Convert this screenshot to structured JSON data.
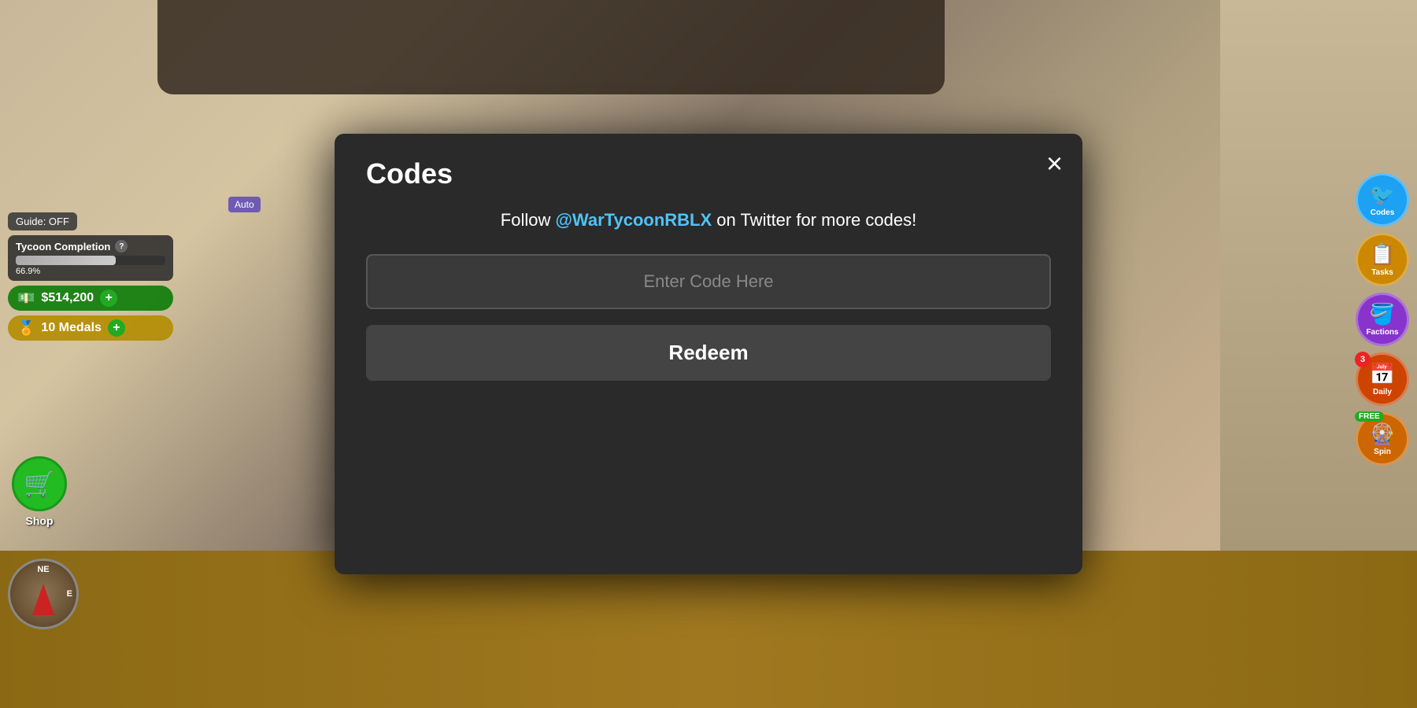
{
  "background": {
    "color": "#c8b89a"
  },
  "hud": {
    "guide_label": "Guide: OFF",
    "tycoon": {
      "label": "Tycoon Completion",
      "progress": 66.9,
      "progress_text": "66.9%"
    },
    "money": {
      "value": "$514,200",
      "icon": "💵"
    },
    "medals": {
      "value": "10 Medals",
      "icon": "🏅"
    },
    "shop": {
      "label": "Shop",
      "icon": "🛒"
    },
    "auto_label": "Auto"
  },
  "right_buttons": [
    {
      "id": "codes",
      "label": "Codes",
      "icon": "🐦",
      "color": "#1da1f2",
      "badge": null
    },
    {
      "id": "tasks",
      "label": "Tasks",
      "icon": "📋",
      "color": "#cc8800",
      "badge": null
    },
    {
      "id": "factions",
      "label": "Factions",
      "icon": "🪣",
      "color": "#8833cc",
      "badge": null
    },
    {
      "id": "daily",
      "label": "Daily",
      "icon": "📅",
      "color": "#cc4400",
      "badge": "3"
    },
    {
      "id": "spin",
      "label": "Spin",
      "icon": "🎡",
      "color": "#cc6600",
      "badge": "FREE"
    }
  ],
  "modal": {
    "title": "Codes",
    "close_label": "×",
    "subtitle_before": "Follow ",
    "twitter_handle": "@WarTycoonRBLX",
    "subtitle_after": " on Twitter for more codes!",
    "input_placeholder": "Enter Code Here",
    "redeem_label": "Redeem"
  },
  "compass": {
    "n_label": "NE",
    "e_label": "E"
  }
}
